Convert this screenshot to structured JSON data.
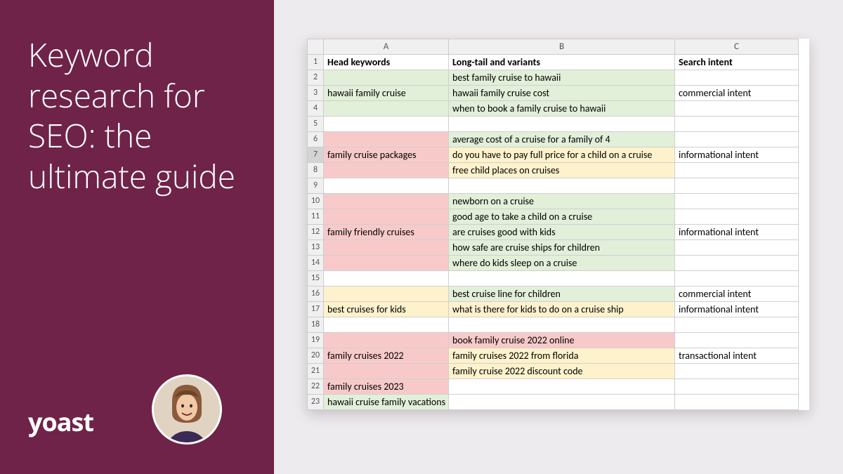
{
  "title": "Keyword research for SEO: the ultimate guide",
  "brand": "yoast",
  "sheet": {
    "columns": [
      "A",
      "B",
      "C"
    ],
    "headers": {
      "A": "Head keywords",
      "B": "Long-tail and variants",
      "C": "Search intent"
    },
    "rows": [
      {
        "n": 1,
        "type": "header"
      },
      {
        "n": 2,
        "A": "",
        "B": "best family cruise to hawaii",
        "C": "",
        "bgA": "bg-green",
        "bgB": "bg-green"
      },
      {
        "n": 3,
        "A": "hawaii family cruise",
        "B": "hawaii family cruise cost",
        "C": "commercial intent",
        "bgA": "bg-green",
        "bgB": "bg-green"
      },
      {
        "n": 4,
        "A": "",
        "B": "when to book a family cruise to hawaii",
        "C": "",
        "bgA": "bg-green",
        "bgB": "bg-green"
      },
      {
        "n": 5,
        "A": "",
        "B": "",
        "C": ""
      },
      {
        "n": 6,
        "A": "",
        "B": "average cost of a cruise for a family of 4",
        "C": "",
        "bgA": "bg-red",
        "bgB": "bg-green"
      },
      {
        "n": 7,
        "A": "family cruise packages",
        "B": "do you have to pay full price for a child on a cruise",
        "C": "informational intent",
        "bgA": "bg-red",
        "bgB": "bg-orange",
        "sel": true
      },
      {
        "n": 8,
        "A": "",
        "B": "free child places on cruises",
        "C": "",
        "bgA": "bg-red",
        "bgB": "bg-orange"
      },
      {
        "n": 9,
        "A": "",
        "B": "",
        "C": ""
      },
      {
        "n": 10,
        "A": "",
        "B": "newborn on a cruise",
        "C": "",
        "bgA": "bg-red",
        "bgB": "bg-green"
      },
      {
        "n": 11,
        "A": "",
        "B": "good age to take a child on a cruise",
        "C": "",
        "bgA": "bg-red",
        "bgB": "bg-green"
      },
      {
        "n": 12,
        "A": "family friendly cruises",
        "B": "are cruises good with kids",
        "C": "informational intent",
        "bgA": "bg-red",
        "bgB": "bg-green"
      },
      {
        "n": 13,
        "A": "",
        "B": "how safe are cruise ships for children",
        "C": "",
        "bgA": "bg-red",
        "bgB": "bg-green"
      },
      {
        "n": 14,
        "A": "",
        "B": "where do kids sleep on a cruise",
        "C": "",
        "bgA": "bg-red",
        "bgB": "bg-green"
      },
      {
        "n": 15,
        "A": "",
        "B": "",
        "C": ""
      },
      {
        "n": 16,
        "A": "",
        "B": "best cruise line for children",
        "C": "commercial intent",
        "bgA": "bg-orange",
        "bgB": "bg-green"
      },
      {
        "n": 17,
        "A": "best cruises for kids",
        "B": "what is there for kids to do on a cruise ship",
        "C": "informational intent",
        "bgA": "bg-orange",
        "bgB": "bg-orange"
      },
      {
        "n": 18,
        "A": "",
        "B": "",
        "C": ""
      },
      {
        "n": 19,
        "A": "",
        "B": "book family cruise 2022 online",
        "C": "",
        "bgA": "bg-red",
        "bgB": "bg-red"
      },
      {
        "n": 20,
        "A": "family cruises 2022",
        "B": "family cruises 2022 from florida",
        "C": "transactional intent",
        "bgA": "bg-red",
        "bgB": "bg-orange"
      },
      {
        "n": 21,
        "A": "",
        "B": "family cruise 2022 discount code",
        "C": "",
        "bgA": "bg-red",
        "bgB": "bg-orange"
      },
      {
        "n": 22,
        "A": "family cruises 2023",
        "B": "",
        "C": "",
        "bgA": "bg-red"
      },
      {
        "n": 23,
        "A": "hawaii cruise family vacations",
        "B": "",
        "C": "",
        "bgA": "bg-green"
      }
    ]
  }
}
